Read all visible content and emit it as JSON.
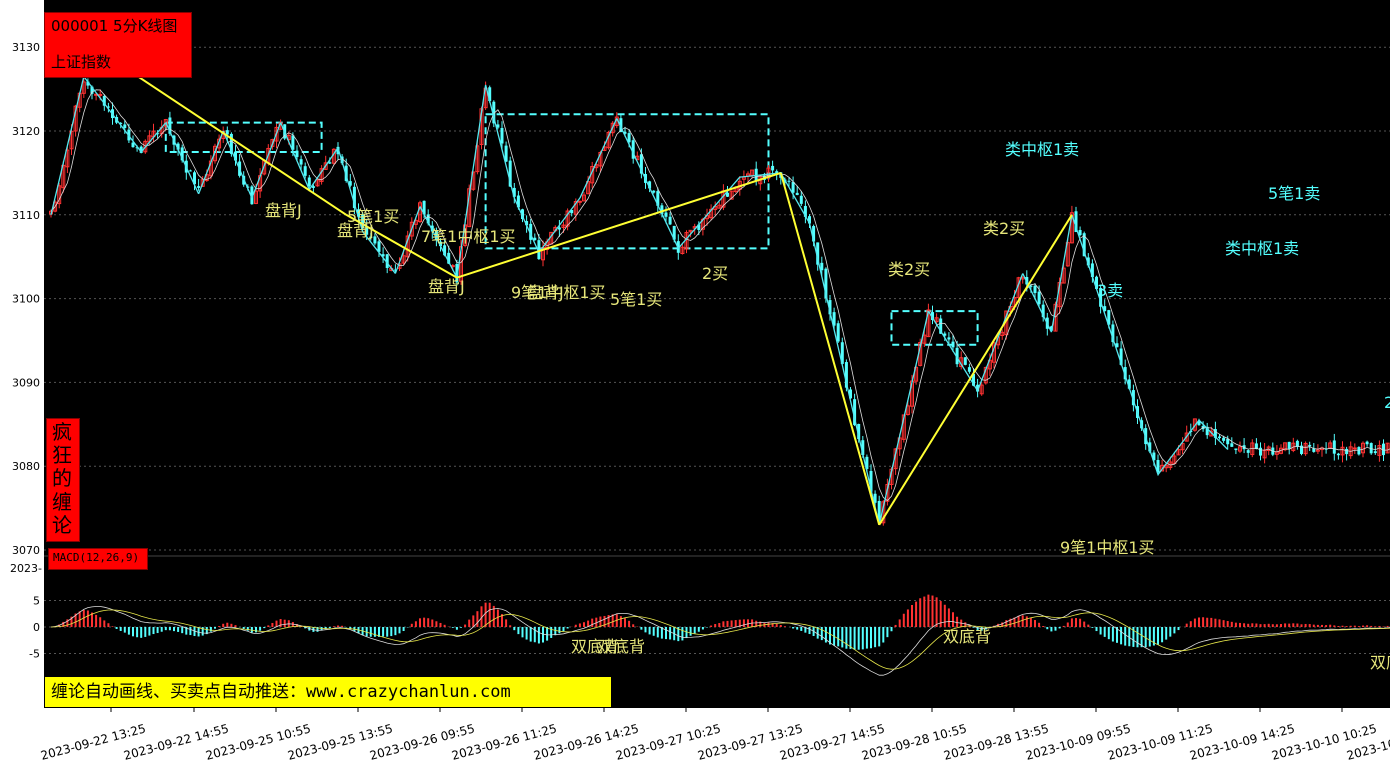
{
  "header": {
    "code_title": "000001 5分K线图",
    "index_name": "上证指数",
    "vertical_brand": [
      "疯",
      "狂",
      "的",
      "缠",
      "论"
    ],
    "macd_label": "MACD(12,26,9)",
    "cut_label": "2023-",
    "ad_text": "缠论自动画线、买卖点自动推送：www.crazychanlun.com"
  },
  "colors": {
    "background": "#000000",
    "up_candle": "#ff3232",
    "down_candle": "#54ffff",
    "stroke_line": "#54e8f0",
    "segment_line": "#ffff33",
    "signal_yellow": "#e6e67a",
    "signal_cyan": "#54ffff",
    "grid": "#555555"
  },
  "chart_data": [
    {
      "type": "candlestick",
      "title": "000001 5分K线图 上证指数",
      "y_ticks": [
        "3130",
        "3120",
        "3110",
        "3100",
        "3090",
        "3080",
        "3070"
      ],
      "ylim": [
        3070,
        3132
      ],
      "x_ticks": [
        "2023-09-22 13:25",
        "2023-09-22 14:55",
        "2023-09-25 10:55",
        "2023-09-25 13:55",
        "2023-09-26 09:55",
        "2023-09-26 11:25",
        "2023-09-26 14:25",
        "2023-09-27 10:25",
        "2023-09-27 13:25",
        "2023-09-27 14:55",
        "2023-09-28 10:55",
        "2023-09-28 13:55",
        "2023-10-09 09:55",
        "2023-10-09 11:25",
        "2023-10-09 14:25",
        "2023-10-10 10:25",
        "2023-10-10"
      ],
      "bi_stroke_points": [
        [
          0,
          3110
        ],
        [
          8,
          3126.5
        ],
        [
          15,
          3122
        ],
        [
          22,
          3117.5
        ],
        [
          28,
          3121
        ],
        [
          36,
          3112.5
        ],
        [
          42,
          3120
        ],
        [
          49,
          3112
        ],
        [
          56,
          3121
        ],
        [
          63,
          3113
        ],
        [
          70,
          3118
        ],
        [
          76,
          3108
        ],
        [
          84,
          3103
        ],
        [
          90,
          3111
        ],
        [
          99,
          3102.5
        ],
        [
          106,
          3125.5
        ],
        [
          113,
          3112
        ],
        [
          119,
          3105.5
        ],
        [
          129,
          3112
        ],
        [
          138,
          3121.5
        ],
        [
          153,
          3106
        ],
        [
          168,
          3114.5
        ],
        [
          178,
          3115
        ],
        [
          185,
          3109
        ],
        [
          202,
          3073
        ],
        [
          214,
          3098.5
        ],
        [
          226,
          3089
        ],
        [
          237,
          3103
        ],
        [
          244,
          3096
        ],
        [
          249,
          3110
        ],
        [
          270,
          3079
        ],
        [
          280,
          3085.5
        ],
        [
          287,
          3082
        ]
      ],
      "segment_points": [
        [
          12,
          3129.5
        ],
        [
          72,
          3110
        ],
        [
          99,
          3102.5
        ],
        [
          178,
          3115
        ],
        [
          202,
          3073
        ],
        [
          249,
          3110
        ]
      ],
      "pivot_zones": [
        {
          "x_from": 28,
          "x_to": 66,
          "low": 3117.5,
          "high": 3121
        },
        {
          "x_from": 106,
          "x_to": 175,
          "low": 3106,
          "high": 3122
        },
        {
          "x_from": 205,
          "x_to": 226,
          "low": 3094.5,
          "high": 3098.5
        }
      ],
      "annotations": [
        {
          "text": "盘背J",
          "color": "yellow"
        },
        {
          "text": "5笔1买",
          "color": "yellow"
        },
        {
          "text": "盘背J",
          "color": "yellow"
        },
        {
          "text": "7笔1中枢1买",
          "color": "yellow"
        },
        {
          "text": "盘背J",
          "color": "yellow"
        },
        {
          "text": "9笔1中枢1买",
          "color": "yellow"
        },
        {
          "text": "盘背J",
          "color": "yellow"
        },
        {
          "text": "5笔1买",
          "color": "yellow"
        },
        {
          "text": "2买",
          "color": "yellow"
        },
        {
          "text": "类2买",
          "color": "yellow"
        },
        {
          "text": "类中枢1卖",
          "color": "cyan"
        },
        {
          "text": "类2买",
          "color": "yellow"
        },
        {
          "text": "9笔1中枢1买",
          "color": "yellow"
        },
        {
          "text": "3卖",
          "color": "cyan"
        },
        {
          "text": "5笔1卖",
          "color": "cyan"
        },
        {
          "text": "类中枢1卖",
          "color": "cyan"
        },
        {
          "text": "2",
          "color": "cyan"
        }
      ]
    },
    {
      "type": "bar",
      "title": "MACD(12,26,9)",
      "y_ticks": [
        "5",
        "0",
        "-5"
      ],
      "ylim": [
        -8.5,
        8.5
      ],
      "series": [
        {
          "name": "MACD(12,26,9)"
        }
      ],
      "annotations": [
        {
          "text": "双底背",
          "color": "yellow"
        },
        {
          "text": "双底背",
          "color": "yellow"
        },
        {
          "text": "双底背",
          "color": "yellow"
        },
        {
          "text": "双底",
          "color": "yellow"
        }
      ]
    }
  ]
}
